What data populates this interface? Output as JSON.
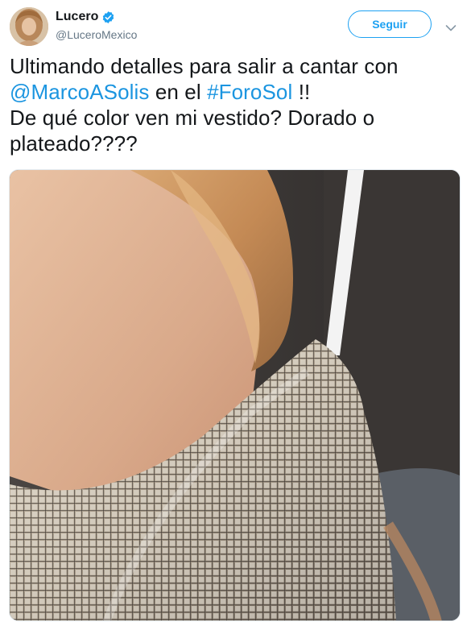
{
  "tweet": {
    "author": {
      "display_name": "Lucero",
      "handle": "@LuceroMexico",
      "verified": true,
      "avatar_icon": "profile-photo"
    },
    "follow_button_label": "Seguir",
    "more_icon": "chevron-down-icon",
    "text": {
      "line1": "Ultimando detalles para salir a cantar con",
      "mention": "@MarcoASolis",
      "line2_mid": " en el ",
      "hashtag": "#ForoSol",
      "line2_end": " !!",
      "line3": "De qué color ven mi vestido? Dorado o",
      "line4": "plateado????"
    },
    "media_icon": "photo-sequin-dress",
    "colors": {
      "accent": "#1da1f2",
      "link": "#1b95e0",
      "text": "#14171a",
      "secondary": "#657786"
    }
  }
}
